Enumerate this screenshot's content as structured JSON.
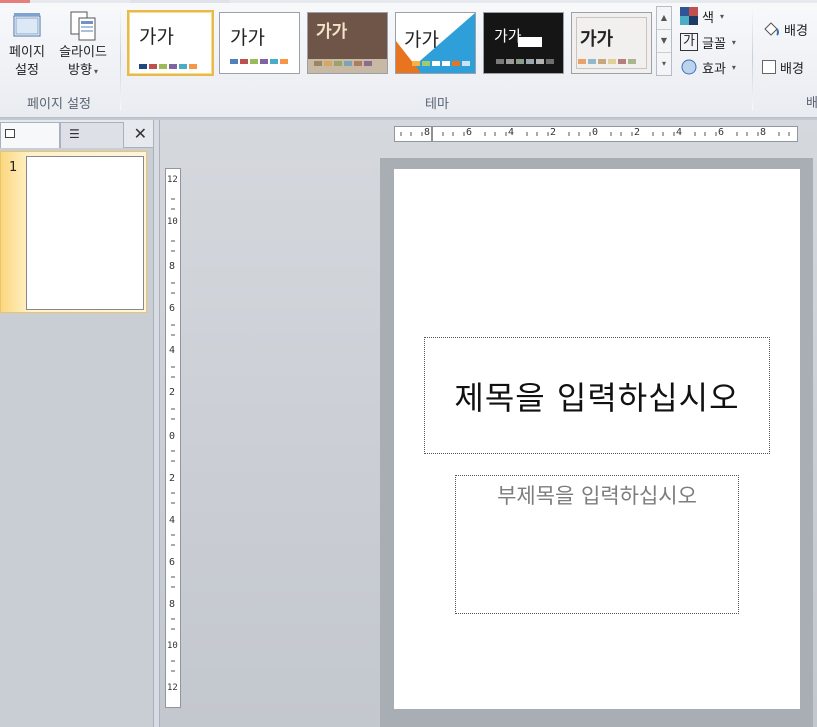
{
  "ribbon": {
    "page_setup_group": {
      "label": "페이지 설정",
      "page_setup_button": {
        "line1": "페이지",
        "line2": "설정"
      },
      "orientation_button": {
        "line1": "슬라이드",
        "line2": "방향"
      }
    },
    "themes_group": {
      "label": "테마",
      "themes": [
        {
          "sample_text": "가가",
          "selected": true
        },
        {
          "sample_text": "가가",
          "selected": false
        },
        {
          "sample_text": "가가",
          "selected": false
        },
        {
          "sample_text": "가가",
          "selected": false
        },
        {
          "sample_text": "가가",
          "selected": false
        },
        {
          "sample_text": "가가",
          "selected": false
        }
      ],
      "colors_label": "색",
      "fonts_label": "글꼴",
      "fonts_icon_text": "가",
      "effects_label": "효과"
    },
    "background_group": {
      "background_styles_label": "배경",
      "hide_background_label": "배경",
      "label_partial": "배"
    }
  },
  "slides_pane": {
    "slide_number": "1"
  },
  "hruler_labels": [
    "8",
    "6",
    "4",
    "2",
    "0",
    "2",
    "4",
    "6",
    "8"
  ],
  "vruler_labels": [
    "12",
    "10",
    "8",
    "6",
    "4",
    "2",
    "0",
    "2",
    "4",
    "6",
    "8",
    "10",
    "12"
  ],
  "slide": {
    "title_placeholder": "제목을 입력하십시오",
    "subtitle_placeholder": "부제목을 입력하십시오"
  },
  "colors": {
    "selection": "#e8b94d",
    "workspace": "#c4c8cf"
  }
}
